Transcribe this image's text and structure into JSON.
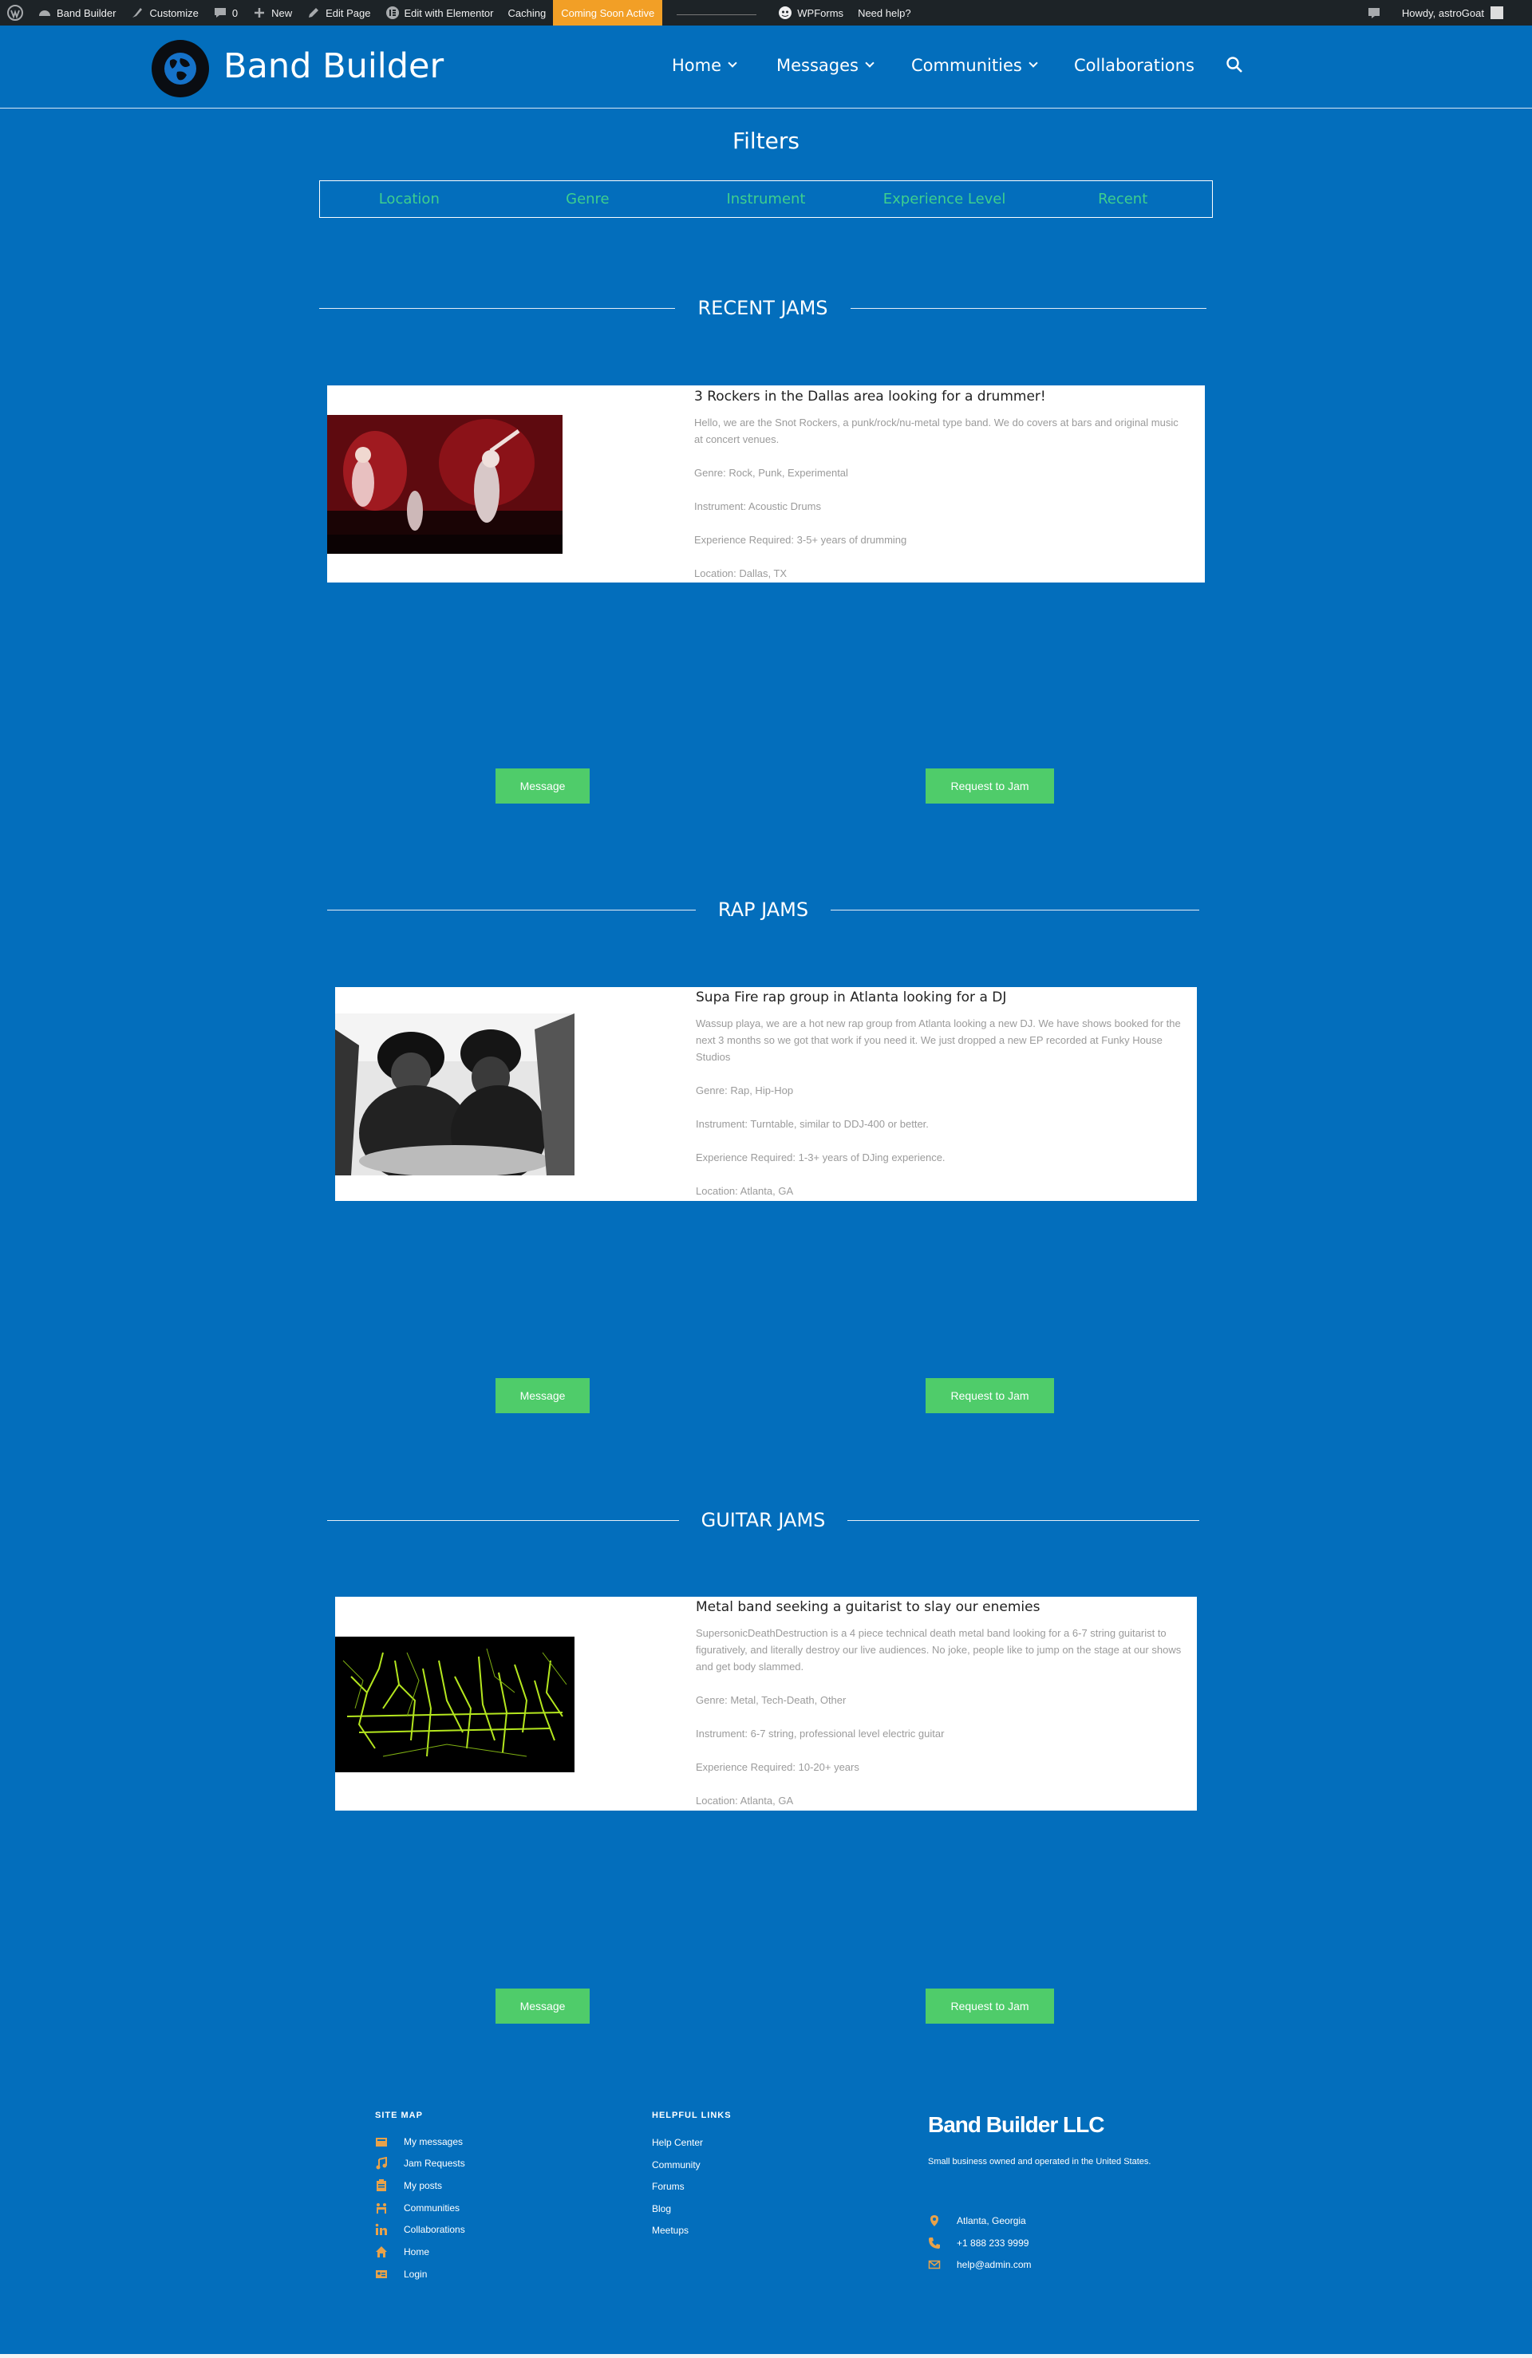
{
  "admin_bar": {
    "site_name": "Band Builder",
    "customize": "Customize",
    "comments_count": "0",
    "new": "New",
    "edit_page": "Edit Page",
    "edit_elementor": "Edit with Elementor",
    "caching": "Caching",
    "coming_soon": "Coming Soon Active",
    "wpforms": "WPForms",
    "need_help": "Need help?",
    "howdy": "Howdy, astroGoat"
  },
  "header": {
    "site_title": "Band Builder",
    "nav": {
      "home": "Home",
      "messages": "Messages",
      "communities": "Communities",
      "collaborations": "Collaborations"
    }
  },
  "filters": {
    "title": "Filters",
    "items": [
      "Location",
      "Genre",
      "Instrument",
      "Experience Level",
      "Recent"
    ]
  },
  "sections": [
    {
      "heading": "RECENT JAMS",
      "card": {
        "title": "3 Rockers in the Dallas area looking for a drummer!",
        "description": "Hello, we are the Snot Rockers, a punk/rock/nu-metal type band. We do covers at bars and original music at concert venues.",
        "genre": "Genre: Rock, Punk, Experimental",
        "instrument": "Instrument: Acoustic Drums",
        "experience": "Experience Required: 3-5+ years of drumming",
        "location": "Location: Dallas, TX"
      },
      "message_btn": "Message",
      "jam_btn": "Request to Jam"
    },
    {
      "heading": "RAP JAMS",
      "card": {
        "title": "Supa Fire rap group in Atlanta looking for a DJ",
        "description": "Wassup playa, we are a hot new rap group from Atlanta looking a new DJ. We have shows booked for the next 3 months so we got that work if you need it. We just dropped a new EP recorded at Funky House Studios",
        "genre": "Genre: Rap, Hip-Hop",
        "instrument": "Instrument: Turntable, similar to DDJ-400 or better.",
        "experience": "Experience Required: 1-3+ years of DJing experience.",
        "location": "Location: Atlanta, GA"
      },
      "message_btn": "Message",
      "jam_btn": "Request to Jam"
    },
    {
      "heading": "GUITAR JAMS",
      "card": {
        "title": "Metal band seeking a guitarist to slay our enemies",
        "description": "SupersonicDeathDestruction is a 4 piece technical death metal band looking for a 6-7 string guitarist to figuratively, and literally destroy our live audiences. No joke, people like to jump on the stage at our shows and get body slammed.",
        "genre": "Genre: Metal, Tech-Death, Other",
        "instrument": "Instrument: 6-7 string, professional level electric guitar",
        "experience": "Experience Required: 10-20+ years",
        "location": "Location: Atlanta, GA"
      },
      "message_btn": "Message",
      "jam_btn": "Request to Jam"
    }
  ],
  "footer": {
    "site_map_heading": "SITE MAP",
    "site_map": [
      "My messages",
      "Jam Requests",
      "My posts",
      "Communities",
      "Collaborations",
      "Home",
      "Login"
    ],
    "helpful_heading": "HELPFUL LINKS",
    "helpful": [
      "Help Center",
      "Community",
      "Forums",
      "Blog",
      "Meetups"
    ],
    "company": "Band Builder LLC",
    "company_desc": "Small business owned and operated in the United States.",
    "address": "Atlanta, Georgia",
    "phone": "+1 888 233 9999",
    "email": "help@admin.com"
  },
  "colors": {
    "background": "#036ebc",
    "filter_text": "#3ecf8e",
    "button": "#4fcc6a",
    "footer_icon": "#e8a24a",
    "admin_bar": "#1d2327",
    "coming_soon": "#f29f26"
  }
}
